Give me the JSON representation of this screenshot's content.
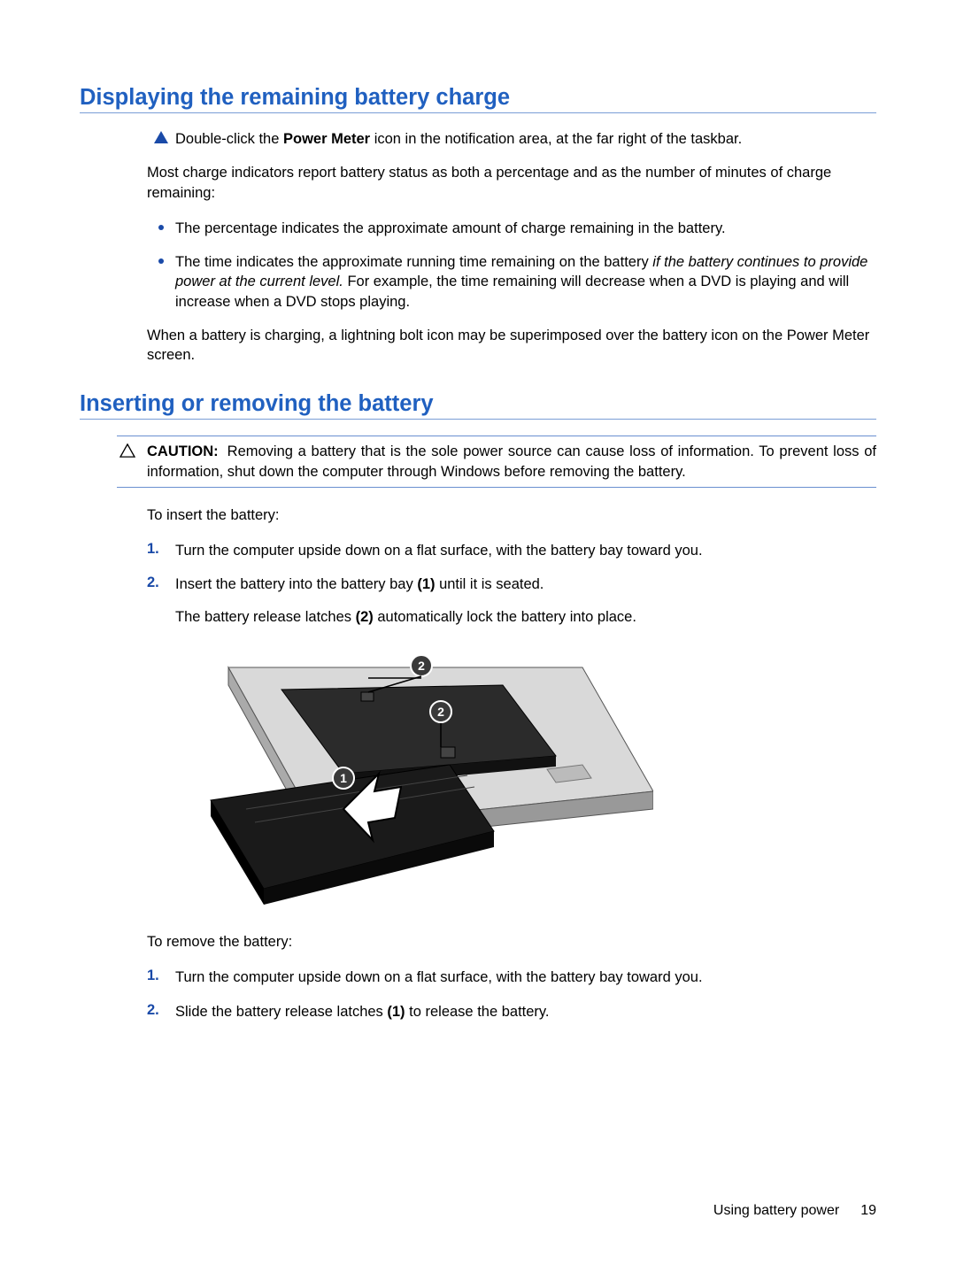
{
  "section1": {
    "heading": "Displaying the remaining battery charge",
    "instruction_pre": "Double-click the ",
    "instruction_bold": "Power Meter",
    "instruction_post": " icon in the notification area, at the far right of the taskbar.",
    "para1": "Most charge indicators report battery status as both a percentage and as the number of minutes of charge remaining:",
    "bullets": [
      {
        "text": "The percentage indicates the approximate amount of charge remaining in the battery."
      },
      {
        "pre": "The time indicates the approximate running time remaining on the battery ",
        "italic": "if the battery continues to provide power at the current level.",
        "post": " For example, the time remaining will decrease when a DVD is playing and will increase when a DVD stops playing."
      }
    ],
    "para2": "When a battery is charging, a lightning bolt icon may be superimposed over the battery icon on the Power Meter screen."
  },
  "section2": {
    "heading": "Inserting or removing the battery",
    "caution_label": "CAUTION:",
    "caution_text": "Removing a battery that is the sole power source can cause loss of information. To prevent loss of information, shut down the computer through Windows before removing the battery.",
    "insert_intro": "To insert the battery:",
    "insert_steps": [
      {
        "num": "1.",
        "text": "Turn the computer upside down on a flat surface, with the battery bay toward you."
      },
      {
        "num": "2.",
        "pre": "Insert the battery into the battery bay ",
        "bold1": "(1)",
        "mid": " until it is seated.",
        "sub_pre": "The battery release latches ",
        "sub_bold": "(2)",
        "sub_post": " automatically lock the battery into place."
      }
    ],
    "remove_intro": "To remove the battery:",
    "remove_steps": [
      {
        "num": "1.",
        "text": "Turn the computer upside down on a flat surface, with the battery bay toward you."
      },
      {
        "num": "2.",
        "pre": "Slide the battery release latches ",
        "bold1": "(1)",
        "post": " to release the battery."
      }
    ]
  },
  "footer": {
    "section": "Using battery power",
    "page": "19"
  },
  "illustration": {
    "callouts": [
      "1",
      "2",
      "2"
    ]
  }
}
